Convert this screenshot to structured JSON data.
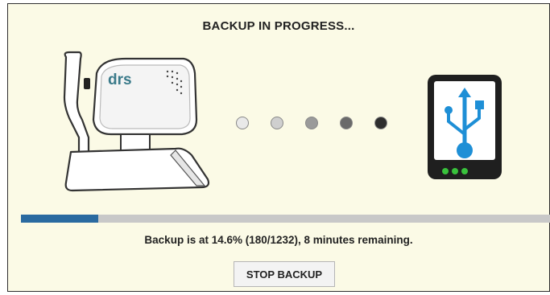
{
  "dialog": {
    "title": "BACKUP IN PROGRESS...",
    "status_text": "Backup is at 14.6% (180/1232),  8 minutes remaining.",
    "stop_button_label": "STOP BACKUP"
  },
  "progress": {
    "percent": 14.6,
    "done": 180,
    "total": 1232
  },
  "source_device": {
    "icon": "drs-camera-icon",
    "logo_text": "drs",
    "logo_color": "#3a7a8a"
  },
  "transfer_dots": [
    {
      "color": "#e9e9e9"
    },
    {
      "color": "#cfcfcf"
    },
    {
      "color": "#9a9a9a"
    },
    {
      "color": "#6a6a6a"
    },
    {
      "color": "#2e2e2e"
    }
  ],
  "target_device": {
    "icon": "usb-drive-icon",
    "usb_color": "#1e8fd6",
    "led_color": "#39c23c"
  },
  "colors": {
    "background": "#fbfae6",
    "progress_fill": "#2a6aa0",
    "progress_track": "#c8c8c8"
  }
}
